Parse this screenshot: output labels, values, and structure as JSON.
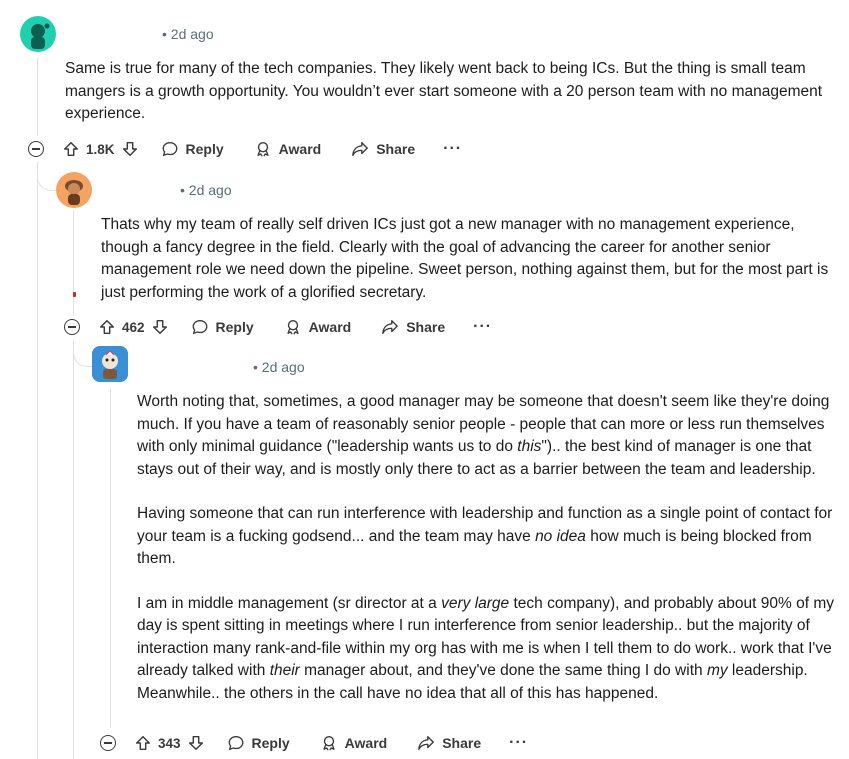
{
  "comments": [
    {
      "time": "2d ago",
      "paragraphs": [
        [
          {
            "t": "Same is true for many of the tech companies. They likely went back to being ICs. But the thing is small team mangers is a growth opportunity. You wouldn’t ever start someone with a 20 person team with no management experience."
          }
        ]
      ],
      "votes": "1.8K"
    },
    {
      "time": "2d ago",
      "paragraphs": [
        [
          {
            "t": "Thats why my team of really self driven ICs just got a new manager with no management experience, though a fancy degree in the field. Clearly with the goal of advancing the career for another senior management role we need down the pipeline. Sweet person, nothing against them, but for the most part is just performing the work of a glorified secretary."
          }
        ]
      ],
      "votes": "462"
    },
    {
      "time": "2d ago",
      "paragraphs": [
        [
          {
            "t": "Worth noting that, sometimes, a good manager may be someone that doesn't seem like they're doing much. If you have a team of reasonably senior people - people that can more or less run themselves with only minimal guidance (\"leadership wants us to do "
          },
          {
            "t": "this",
            "i": true
          },
          {
            "t": "\").. the best kind of manager is one that stays out of their way, and is mostly only there to act as a barrier between the team and leadership."
          }
        ],
        [
          {
            "t": "Having someone that can run interference with leadership and function as a single point of contact for your team is a fucking godsend... and the team may have "
          },
          {
            "t": "no idea",
            "i": true
          },
          {
            "t": " how much is being blocked from them."
          }
        ],
        [
          {
            "t": "I am in middle management (sr director at a "
          },
          {
            "t": "very large",
            "i": true
          },
          {
            "t": " tech company), and probably about 90% of my day is spent sitting in meetings where I run interference from senior leadership.. but the majority of interaction many rank-and-file within my org has with me is when I tell them to do work.. work that I've already talked with "
          },
          {
            "t": "their",
            "i": true
          },
          {
            "t": " manager about, and they've done the same thing I do with "
          },
          {
            "t": "my",
            "i": true
          },
          {
            "t": " leadership. Meanwhile.. the others in the call have no idea that all of this has happened."
          }
        ]
      ],
      "votes": "343"
    }
  ],
  "actions": {
    "reply_label": "Reply",
    "award_label": "Award",
    "share_label": "Share",
    "more_label": "···"
  },
  "colors": {
    "avatar1_bg": "#1fcfb0",
    "avatar2_bg": "#f4a462",
    "avatar3_bg": "#3a8fd6",
    "thread_line": "#e0e0e0",
    "meta_text": "#576f76"
  },
  "icons": {
    "upvote": "arrow-up-icon",
    "downvote": "arrow-down-icon",
    "reply": "speech-bubble-icon",
    "award": "award-icon",
    "share": "share-arrow-icon",
    "collapse": "collapse-minus-icon"
  }
}
